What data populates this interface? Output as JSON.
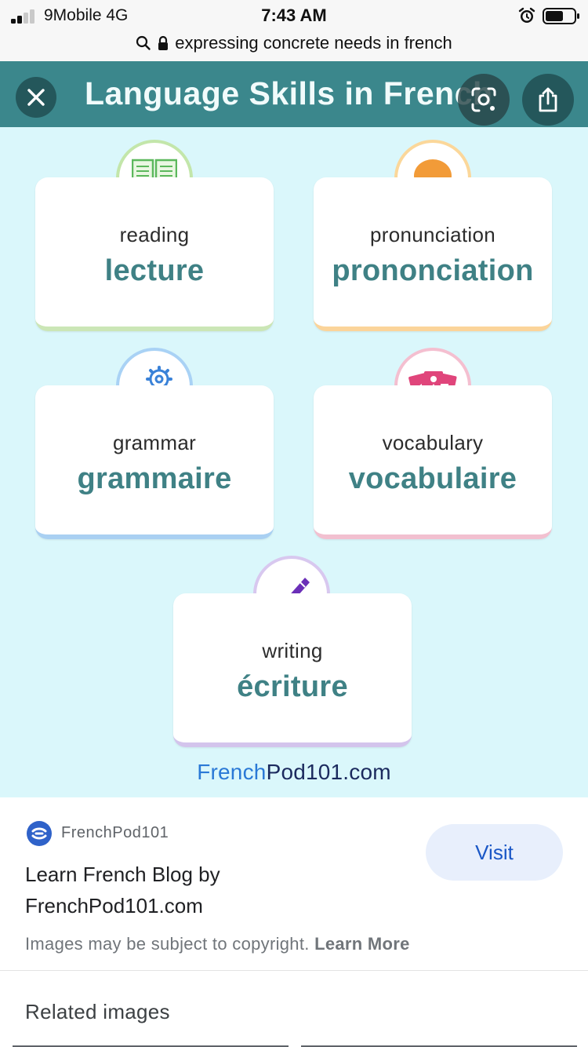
{
  "status_bar": {
    "carrier": "9Mobile  4G",
    "time": "7:43 AM"
  },
  "url_bar": {
    "query": "expressing concrete needs in french"
  },
  "image": {
    "title": "Language Skills in French",
    "cards": [
      {
        "en": "reading",
        "fr": "lecture",
        "icon": "book-icon",
        "color": "#b7e0a2"
      },
      {
        "en": "pronunciation",
        "fr": "prononciation",
        "icon": "speech-bubble-icon",
        "color": "#fbd79a"
      },
      {
        "en": "grammar",
        "fr": "grammaire",
        "icon": "gears-icon",
        "color": "#a9d2f5"
      },
      {
        "en": "vocabulary",
        "fr": "vocabulaire",
        "icon": "flashcards-icon",
        "color": "#f4bfd0"
      },
      {
        "en": "writing",
        "fr": "écriture",
        "icon": "pen-icon",
        "color": "#d8c8ef"
      }
    ],
    "site_logo": {
      "part1": "French",
      "part2": "Pod101.com"
    }
  },
  "info": {
    "source_name": "FrenchPod101",
    "page_title": "Learn French Blog by FrenchPod101.com",
    "visit_label": "Visit",
    "copyright_text": "Images may be subject to copyright.",
    "learn_more": "Learn More",
    "related_label": "Related images"
  },
  "colors": {
    "banner": "#3b878c",
    "image_background": "#daf7fb",
    "french_word": "#3f8185",
    "visit_button": "#e8effc",
    "link_blue": "#1a57c6"
  }
}
